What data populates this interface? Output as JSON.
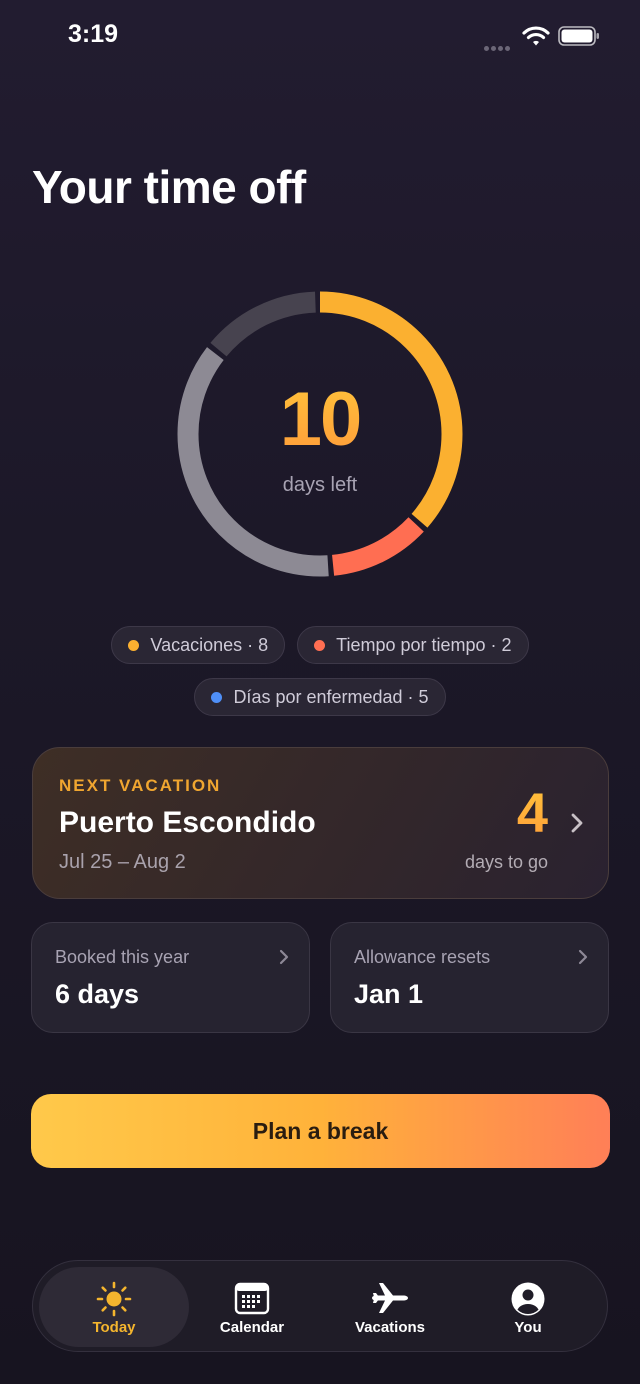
{
  "status_bar": {
    "time": "3:19"
  },
  "page": {
    "title": "Your time off"
  },
  "ring": {
    "number": "10",
    "label": "days left",
    "segments": [
      {
        "name": "vacation-remaining",
        "fraction": 0.37,
        "color": "#fbb030"
      },
      {
        "name": "comp-time",
        "fraction": 0.12,
        "color": "#ff6e52"
      },
      {
        "name": "used",
        "fraction": 0.37,
        "color": "#8d8a94"
      },
      {
        "name": "unused",
        "fraction": 0.14,
        "color": "#47434f"
      }
    ]
  },
  "chips": [
    {
      "label": "Vacaciones · 8",
      "color": "#fbb030"
    },
    {
      "label": "Tiempo por tiempo · 2",
      "color": "#ff6e52"
    },
    {
      "label": "Días por enfermedad · 5",
      "color": "#4f8ff7"
    }
  ],
  "next_vacation": {
    "kicker": "NEXT VACATION",
    "title": "Puerto Escondido",
    "dates": "Jul 25 – Aug 2",
    "count": "4",
    "count_label": "days to go"
  },
  "stats": {
    "booked": {
      "label": "Booked this year",
      "value": "6 days"
    },
    "resets": {
      "label": "Allowance resets",
      "value": "Jan 1"
    }
  },
  "cta": {
    "label": "Plan a break"
  },
  "tabs": [
    {
      "label": "Today",
      "icon": "sun-icon",
      "active": true
    },
    {
      "label": "Calendar",
      "icon": "calendar-icon",
      "active": false
    },
    {
      "label": "Vacations",
      "icon": "airplane-icon",
      "active": false
    },
    {
      "label": "You",
      "icon": "person-icon",
      "active": false
    }
  ]
}
